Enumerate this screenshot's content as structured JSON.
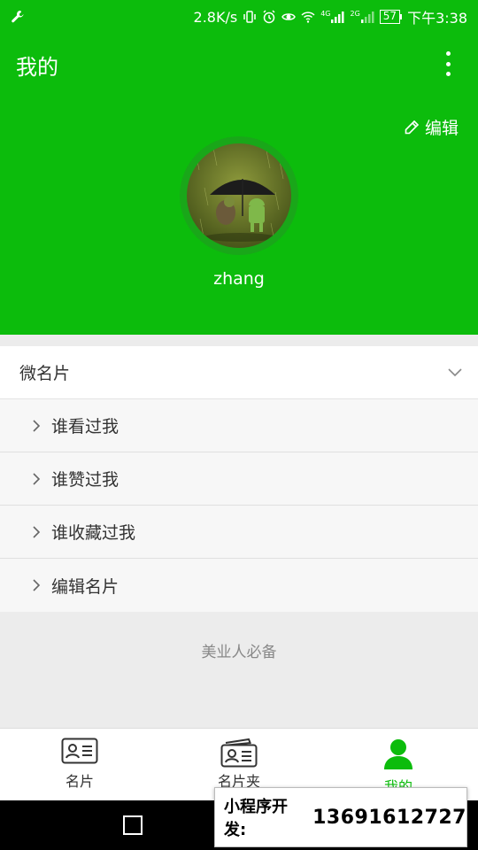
{
  "status_bar": {
    "speed": "2.8K/s",
    "network_4g": "4G",
    "network_2g": "2G",
    "battery": "57",
    "time": "下午3:38"
  },
  "header": {
    "title": "我的",
    "edit_label": "编辑",
    "username": "zhang"
  },
  "card": {
    "title": "微名片",
    "items": [
      {
        "label": "谁看过我"
      },
      {
        "label": "谁赞过我"
      },
      {
        "label": "谁收藏过我"
      },
      {
        "label": "编辑名片"
      }
    ]
  },
  "footer_note": "美业人必备",
  "tabs": [
    {
      "label": "名片",
      "icon": "id-card-icon",
      "active": false
    },
    {
      "label": "名片夹",
      "icon": "card-holder-icon",
      "active": false
    },
    {
      "label": "我的",
      "icon": "user-icon",
      "active": true
    }
  ],
  "promo": {
    "label": "小程序开发:",
    "phone": "13691612727"
  },
  "colors": {
    "brand_green": "#0cbc0c",
    "background": "#ececec"
  }
}
